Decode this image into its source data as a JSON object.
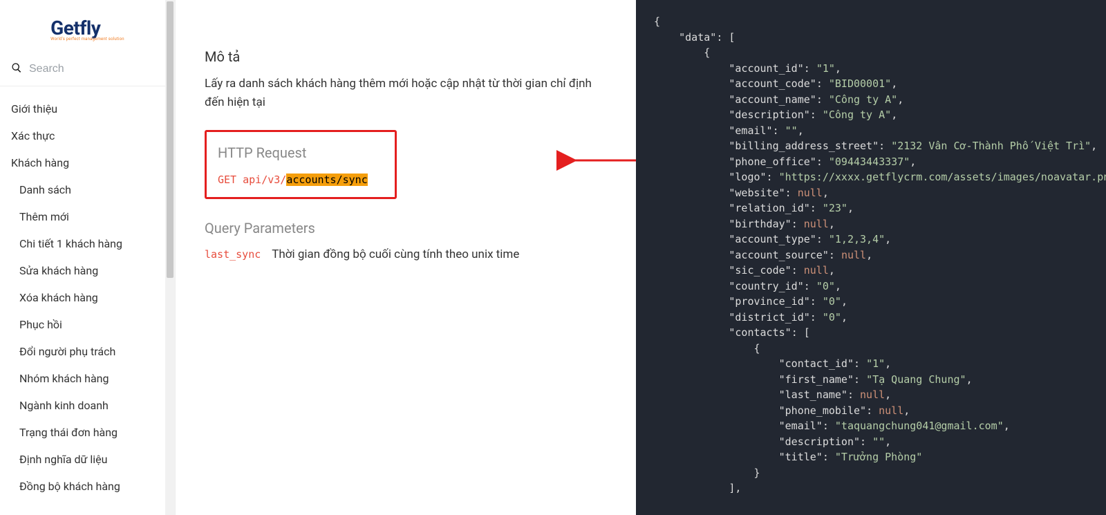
{
  "logo": {
    "main": "Getfly",
    "sub": "World's perfect management solution"
  },
  "search": {
    "placeholder": "Search"
  },
  "sidebar": {
    "items": [
      {
        "label": "Giới thiệu",
        "child": false
      },
      {
        "label": "Xác thực",
        "child": false
      },
      {
        "label": "Khách hàng",
        "child": false
      },
      {
        "label": "Danh sách",
        "child": true
      },
      {
        "label": "Thêm mới",
        "child": true
      },
      {
        "label": "Chi tiết 1 khách hàng",
        "child": true
      },
      {
        "label": "Sửa khách hàng",
        "child": true
      },
      {
        "label": "Xóa khách hàng",
        "child": true
      },
      {
        "label": "Phục hồi",
        "child": true
      },
      {
        "label": "Đổi người phụ trách",
        "child": true
      },
      {
        "label": "Nhóm khách hàng",
        "child": true
      },
      {
        "label": "Ngành kinh doanh",
        "child": true
      },
      {
        "label": "Trạng thái đơn hàng",
        "child": true
      },
      {
        "label": "Định nghĩa dữ liệu",
        "child": true
      },
      {
        "label": "Đồng bộ khách hàng",
        "child": true
      }
    ]
  },
  "main": {
    "mota_title": "Mô tả",
    "mota_body": "Lấy ra danh sách khách hàng thêm mới hoặc cập nhật từ thời gian chỉ định đến hiện tại",
    "http_title": "HTTP Request",
    "http_method": "GET",
    "http_path": "api/v3/",
    "http_hl": "accounts/sync",
    "qp_title": "Query Parameters",
    "qp_name": "last_sync",
    "qp_desc": "Thời gian đồng bộ cuối cùng tính theo unix time"
  },
  "code_tokens": [
    {
      "indent": 0,
      "tokens": [
        {
          "t": "{",
          "c": "p"
        }
      ]
    },
    {
      "indent": 1,
      "tokens": [
        {
          "t": "\"data\"",
          "c": "key"
        },
        {
          "t": ": [",
          "c": "p"
        }
      ]
    },
    {
      "indent": 2,
      "tokens": [
        {
          "t": "{",
          "c": "p"
        }
      ]
    },
    {
      "indent": 3,
      "tokens": [
        {
          "t": "\"account_id\"",
          "c": "key"
        },
        {
          "t": ": ",
          "c": "p"
        },
        {
          "t": "\"1\"",
          "c": "s"
        },
        {
          "t": ",",
          "c": "p"
        }
      ]
    },
    {
      "indent": 3,
      "tokens": [
        {
          "t": "\"account_code\"",
          "c": "key"
        },
        {
          "t": ": ",
          "c": "p"
        },
        {
          "t": "\"BID00001\"",
          "c": "s"
        },
        {
          "t": ",",
          "c": "p"
        }
      ]
    },
    {
      "indent": 3,
      "tokens": [
        {
          "t": "\"account_name\"",
          "c": "key"
        },
        {
          "t": ": ",
          "c": "p"
        },
        {
          "t": "\"Công ty A\"",
          "c": "s"
        },
        {
          "t": ",",
          "c": "p"
        }
      ]
    },
    {
      "indent": 3,
      "tokens": [
        {
          "t": "\"description\"",
          "c": "key"
        },
        {
          "t": ": ",
          "c": "p"
        },
        {
          "t": "\"Công ty A\"",
          "c": "s"
        },
        {
          "t": ",",
          "c": "p"
        }
      ]
    },
    {
      "indent": 3,
      "tokens": [
        {
          "t": "\"email\"",
          "c": "key"
        },
        {
          "t": ": ",
          "c": "p"
        },
        {
          "t": "\"\"",
          "c": "s"
        },
        {
          "t": ",",
          "c": "p"
        }
      ]
    },
    {
      "indent": 3,
      "tokens": [
        {
          "t": "\"billing_address_street\"",
          "c": "key"
        },
        {
          "t": ": ",
          "c": "p"
        },
        {
          "t": "\"2132 Vân Cơ-Thành Phố Việt Trì\"",
          "c": "s"
        },
        {
          "t": ",",
          "c": "p"
        }
      ]
    },
    {
      "indent": 3,
      "tokens": [
        {
          "t": "\"phone_office\"",
          "c": "key"
        },
        {
          "t": ": ",
          "c": "p"
        },
        {
          "t": "\"09443443337\"",
          "c": "s"
        },
        {
          "t": ",",
          "c": "p"
        }
      ]
    },
    {
      "indent": 3,
      "tokens": [
        {
          "t": "\"logo\"",
          "c": "key"
        },
        {
          "t": ": ",
          "c": "p"
        },
        {
          "t": "\"https://xxxx.getflycrm.com/assets/images/noavatar.png\"",
          "c": "s"
        },
        {
          "t": ",",
          "c": "p"
        }
      ]
    },
    {
      "indent": 3,
      "tokens": [
        {
          "t": "\"website\"",
          "c": "key"
        },
        {
          "t": ": ",
          "c": "p"
        },
        {
          "t": "null",
          "c": "n"
        },
        {
          "t": ",",
          "c": "p"
        }
      ]
    },
    {
      "indent": 3,
      "tokens": [
        {
          "t": "\"relation_id\"",
          "c": "key"
        },
        {
          "t": ": ",
          "c": "p"
        },
        {
          "t": "\"23\"",
          "c": "s"
        },
        {
          "t": ",",
          "c": "p"
        }
      ]
    },
    {
      "indent": 3,
      "tokens": [
        {
          "t": "\"birthday\"",
          "c": "key"
        },
        {
          "t": ": ",
          "c": "p"
        },
        {
          "t": "null",
          "c": "n"
        },
        {
          "t": ",",
          "c": "p"
        }
      ]
    },
    {
      "indent": 3,
      "tokens": [
        {
          "t": "\"account_type\"",
          "c": "key"
        },
        {
          "t": ": ",
          "c": "p"
        },
        {
          "t": "\"1,2,3,4\"",
          "c": "s"
        },
        {
          "t": ",",
          "c": "p"
        }
      ]
    },
    {
      "indent": 3,
      "tokens": [
        {
          "t": "\"account_source\"",
          "c": "key"
        },
        {
          "t": ": ",
          "c": "p"
        },
        {
          "t": "null",
          "c": "n"
        },
        {
          "t": ",",
          "c": "p"
        }
      ]
    },
    {
      "indent": 3,
      "tokens": [
        {
          "t": "\"sic_code\"",
          "c": "key"
        },
        {
          "t": ": ",
          "c": "p"
        },
        {
          "t": "null",
          "c": "n"
        },
        {
          "t": ",",
          "c": "p"
        }
      ]
    },
    {
      "indent": 3,
      "tokens": [
        {
          "t": "\"country_id\"",
          "c": "key"
        },
        {
          "t": ": ",
          "c": "p"
        },
        {
          "t": "\"0\"",
          "c": "s"
        },
        {
          "t": ",",
          "c": "p"
        }
      ]
    },
    {
      "indent": 3,
      "tokens": [
        {
          "t": "\"province_id\"",
          "c": "key"
        },
        {
          "t": ": ",
          "c": "p"
        },
        {
          "t": "\"0\"",
          "c": "s"
        },
        {
          "t": ",",
          "c": "p"
        }
      ]
    },
    {
      "indent": 3,
      "tokens": [
        {
          "t": "\"district_id\"",
          "c": "key"
        },
        {
          "t": ": ",
          "c": "p"
        },
        {
          "t": "\"0\"",
          "c": "s"
        },
        {
          "t": ",",
          "c": "p"
        }
      ]
    },
    {
      "indent": 3,
      "tokens": [
        {
          "t": "\"contacts\"",
          "c": "key"
        },
        {
          "t": ": [",
          "c": "p"
        }
      ]
    },
    {
      "indent": 4,
      "tokens": [
        {
          "t": "{",
          "c": "p"
        }
      ]
    },
    {
      "indent": 5,
      "tokens": [
        {
          "t": "\"contact_id\"",
          "c": "key"
        },
        {
          "t": ": ",
          "c": "p"
        },
        {
          "t": "\"1\"",
          "c": "s"
        },
        {
          "t": ",",
          "c": "p"
        }
      ]
    },
    {
      "indent": 5,
      "tokens": [
        {
          "t": "\"first_name\"",
          "c": "key"
        },
        {
          "t": ": ",
          "c": "p"
        },
        {
          "t": "\"Tạ Quang Chung\"",
          "c": "s"
        },
        {
          "t": ",",
          "c": "p"
        }
      ]
    },
    {
      "indent": 5,
      "tokens": [
        {
          "t": "\"last_name\"",
          "c": "key"
        },
        {
          "t": ": ",
          "c": "p"
        },
        {
          "t": "null",
          "c": "n"
        },
        {
          "t": ",",
          "c": "p"
        }
      ]
    },
    {
      "indent": 5,
      "tokens": [
        {
          "t": "\"phone_mobile\"",
          "c": "key"
        },
        {
          "t": ": ",
          "c": "p"
        },
        {
          "t": "null",
          "c": "n"
        },
        {
          "t": ",",
          "c": "p"
        }
      ]
    },
    {
      "indent": 5,
      "tokens": [
        {
          "t": "\"email\"",
          "c": "key"
        },
        {
          "t": ": ",
          "c": "p"
        },
        {
          "t": "\"taquangchung041@gmail.com\"",
          "c": "s"
        },
        {
          "t": ",",
          "c": "p"
        }
      ]
    },
    {
      "indent": 5,
      "tokens": [
        {
          "t": "\"description\"",
          "c": "key"
        },
        {
          "t": ": ",
          "c": "p"
        },
        {
          "t": "\"\"",
          "c": "s"
        },
        {
          "t": ",",
          "c": "p"
        }
      ]
    },
    {
      "indent": 5,
      "tokens": [
        {
          "t": "\"title\"",
          "c": "key"
        },
        {
          "t": ": ",
          "c": "p"
        },
        {
          "t": "\"Trưởng Phòng\"",
          "c": "s"
        }
      ]
    },
    {
      "indent": 4,
      "tokens": [
        {
          "t": "}",
          "c": "p"
        }
      ]
    },
    {
      "indent": 3,
      "tokens": [
        {
          "t": "],",
          "c": "p"
        }
      ]
    }
  ]
}
